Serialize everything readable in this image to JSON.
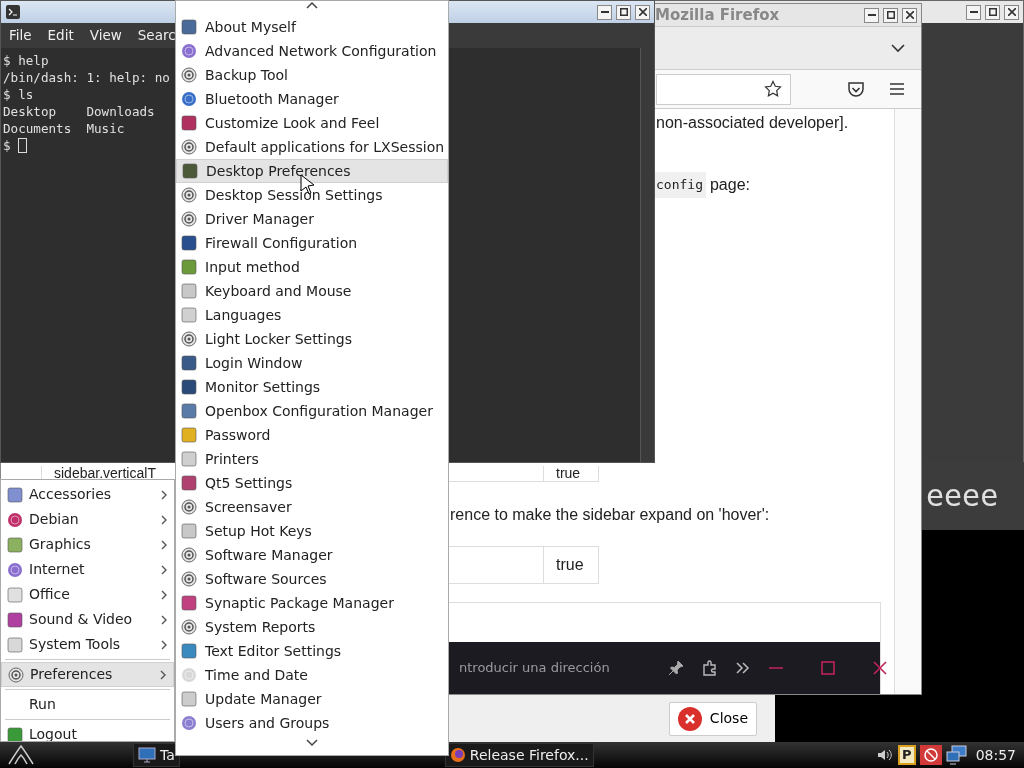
{
  "background_window": {
    "text": "eeee"
  },
  "firefox": {
    "title": "Mozilla Firefox",
    "text_1": "non-associated developer].",
    "config_line": {
      "code": "config",
      "text": "page:"
    },
    "rows_1": [
      {
        "name": "sidebar.verticalT",
        "value": "true"
      }
    ],
    "text_2": "rence to make the sidebar expand on 'hover':",
    "rows_2": [
      {
        "value": "true"
      }
    ],
    "address_bar": {
      "placeholder": "ntroducir una dirección"
    }
  },
  "dialog": {
    "button": "Close"
  },
  "terminal": {
    "menu": [
      "File",
      "Edit",
      "View",
      "Searc"
    ],
    "lines": [
      "$ help",
      "/bin/dash: 1: help: no",
      "$ ls",
      "Desktop    Downloads",
      "Documents  Music",
      "$ "
    ]
  },
  "start_menu": {
    "groups": [
      [
        {
          "label": "Accessories",
          "submenu": true,
          "selected": false
        },
        {
          "label": "Debian",
          "submenu": true,
          "selected": false
        },
        {
          "label": "Graphics",
          "submenu": true,
          "selected": false
        },
        {
          "label": "Internet",
          "submenu": true,
          "selected": false
        },
        {
          "label": "Office",
          "submenu": true,
          "selected": false
        },
        {
          "label": "Sound & Video",
          "submenu": true,
          "selected": false
        },
        {
          "label": "System Tools",
          "submenu": true,
          "selected": false
        }
      ],
      [
        {
          "label": "Preferences",
          "submenu": true,
          "selected": true
        }
      ],
      [
        {
          "label": "Run",
          "submenu": false,
          "selected": false
        }
      ],
      [
        {
          "label": "Logout",
          "submenu": false,
          "selected": false
        }
      ]
    ]
  },
  "preferences_menu": {
    "items": [
      {
        "label": "About Myself",
        "selected": false
      },
      {
        "label": "Advanced Network Configuration",
        "selected": false
      },
      {
        "label": "Backup Tool",
        "selected": false
      },
      {
        "label": "Bluetooth Manager",
        "selected": false
      },
      {
        "label": "Customize Look and Feel",
        "selected": false
      },
      {
        "label": "Default applications for LXSession",
        "selected": false
      },
      {
        "label": "Desktop Preferences",
        "selected": true
      },
      {
        "label": "Desktop Session Settings",
        "selected": false
      },
      {
        "label": "Driver Manager",
        "selected": false
      },
      {
        "label": "Firewall Configuration",
        "selected": false
      },
      {
        "label": "Input method",
        "selected": false
      },
      {
        "label": "Keyboard and Mouse",
        "selected": false
      },
      {
        "label": "Languages",
        "selected": false
      },
      {
        "label": "Light Locker Settings",
        "selected": false
      },
      {
        "label": "Login Window",
        "selected": false
      },
      {
        "label": "Monitor Settings",
        "selected": false
      },
      {
        "label": "Openbox Configuration Manager",
        "selected": false
      },
      {
        "label": "Password",
        "selected": false
      },
      {
        "label": "Printers",
        "selected": false
      },
      {
        "label": "Qt5 Settings",
        "selected": false
      },
      {
        "label": "Screensaver",
        "selected": false
      },
      {
        "label": "Setup Hot Keys",
        "selected": false
      },
      {
        "label": "Software Manager",
        "selected": false
      },
      {
        "label": "Software Sources",
        "selected": false
      },
      {
        "label": "Synaptic Package Manager",
        "selected": false
      },
      {
        "label": "System Reports",
        "selected": false
      },
      {
        "label": "Text Editor Settings",
        "selected": false
      },
      {
        "label": "Time and Date",
        "selected": false
      },
      {
        "label": "Update Manager",
        "selected": false
      },
      {
        "label": "Users and Groups",
        "selected": false
      }
    ]
  },
  "taskbar": {
    "tasks": [
      {
        "label": "Ta",
        "kind": "terminal"
      },
      {
        "label": "Release Firefox...",
        "kind": "browser"
      }
    ],
    "tray_badge": "P",
    "clock": "08:57"
  }
}
